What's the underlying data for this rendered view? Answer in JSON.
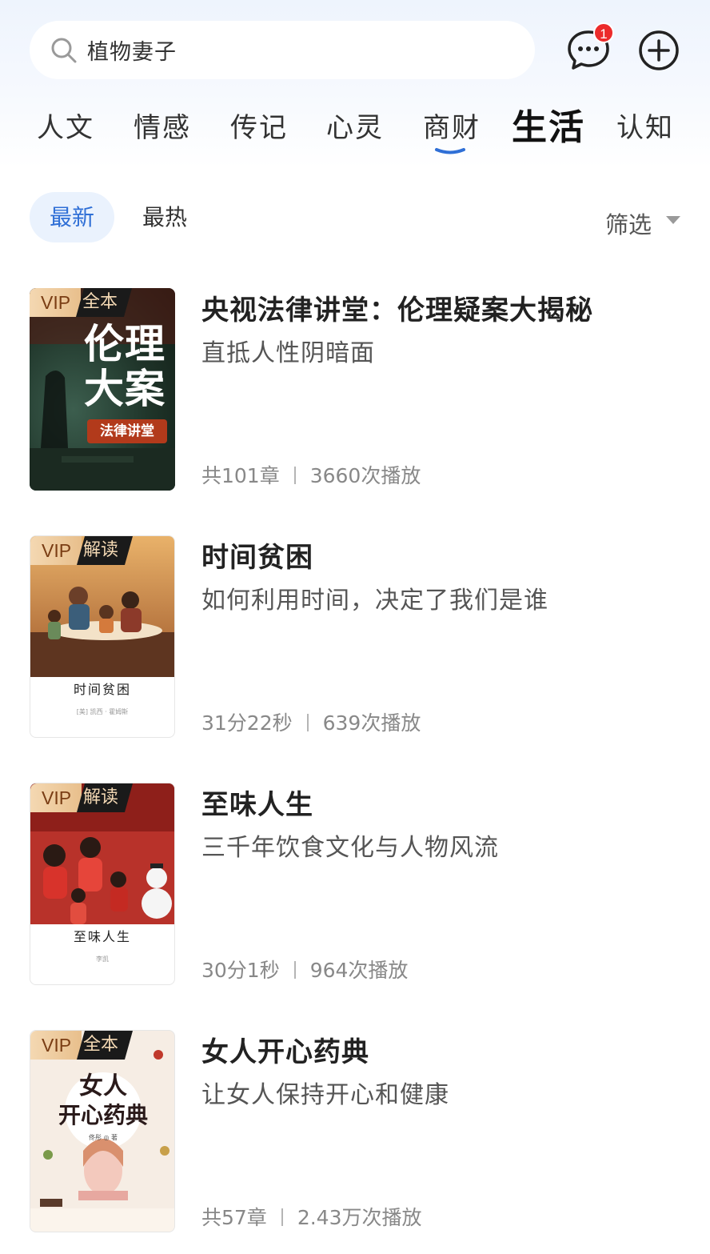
{
  "search": {
    "query": "植物妻子"
  },
  "header": {
    "message_badge": "1"
  },
  "tabs": [
    "人文",
    "情感",
    "传记",
    "心灵",
    "商财",
    "生活",
    "认知"
  ],
  "active_tab": "生活",
  "sort": {
    "latest": "最新",
    "hottest": "最热",
    "filter": "筛选"
  },
  "colors": {
    "accent": "#2f6fd6",
    "badge": "#ec2b2b",
    "vip_gold": "#e8bf8c"
  },
  "items": [
    {
      "title": "央视法律讲堂：伦理疑案大揭秘",
      "subtitle": "直抵人性阴暗面",
      "chapters": "共101章",
      "plays": "3660次播放",
      "tag_vip": "VIP",
      "tag_kind": "全本",
      "cover": {
        "big_text_1": "伦理",
        "big_text_2": "大案",
        "badge": "法律讲堂"
      }
    },
    {
      "title": "时间贫困",
      "subtitle": "如何利用时间，决定了我们是谁",
      "chapters": "31分22秒",
      "plays": "639次播放",
      "tag_vip": "VIP",
      "tag_kind": "解读",
      "cover": {
        "title": "时间贫困",
        "author": "[美] 凯西 · 霍姆斯"
      }
    },
    {
      "title": "至味人生",
      "subtitle": "三千年饮食文化与人物风流",
      "chapters": "30分1秒",
      "plays": "964次播放",
      "tag_vip": "VIP",
      "tag_kind": "解读",
      "cover": {
        "title": "至味人生",
        "author": "李凯"
      }
    },
    {
      "title": "女人开心药典",
      "subtitle": "让女人保持开心和健康",
      "chapters": "共57章",
      "plays": "2.43万次播放",
      "tag_vip": "VIP",
      "tag_kind": "全本",
      "cover": {
        "big_text_1": "女人",
        "big_text_2": "开心药典",
        "author": "佟彤 ◎ 著"
      }
    }
  ]
}
